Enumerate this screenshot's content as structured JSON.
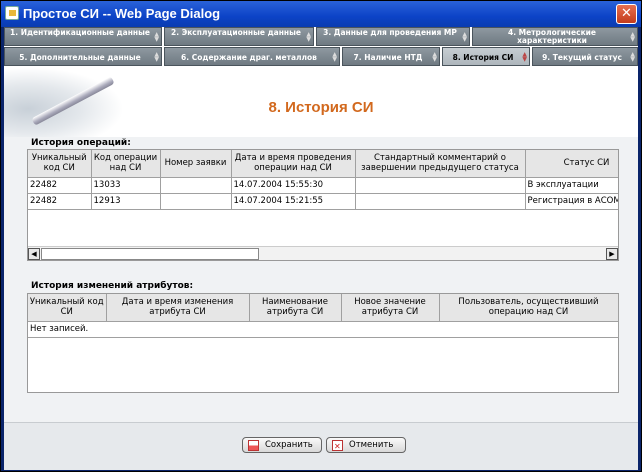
{
  "window": {
    "title": "Простое СИ -- Web Page Dialog",
    "close_glyph": "✕"
  },
  "tabs": [
    {
      "label": "1. Идентификационные данные"
    },
    {
      "label": "2. Эксплуатационные данные"
    },
    {
      "label": "3. Данные для проведения МР"
    },
    {
      "label": "4. Метрологические характеристики"
    },
    {
      "label": "5. Дополнительные данные"
    },
    {
      "label": "6. Содержание драг. металлов"
    },
    {
      "label": "7. Наличие НТД"
    },
    {
      "label": "8. История СИ"
    },
    {
      "label": "9. Текущий статус"
    }
  ],
  "page": {
    "title": "8. История СИ"
  },
  "operations": {
    "label": "История операций:",
    "columns": [
      "Уникальный код СИ",
      "Код операции над СИ",
      "Номер заявки",
      "Дата и время проведения операции над СИ",
      "Стандартный комментарий о завершении предыдущего статуса",
      "Статус СИ"
    ],
    "rows": [
      [
        "22482",
        "13033",
        "",
        "14.07.2004 15:55:30",
        "",
        "В эксплуатации"
      ],
      [
        "22482",
        "12913",
        "",
        "14.07.2004 15:21:55",
        "",
        "Регистрация в АСОМ"
      ]
    ]
  },
  "attributes": {
    "label": "История изменений атрибутов:",
    "columns": [
      "Уникальный код СИ",
      "Дата и время изменения атрибута СИ",
      "Наименование атрибута СИ",
      "Новое значение атрибута СИ",
      "Пользователь, осуществивший операцию над СИ"
    ],
    "empty_text": "Нет записей."
  },
  "buttons": {
    "save": "Сохранить",
    "cancel": "Отменить"
  },
  "scroll": {
    "left_glyph": "◀",
    "right_glyph": "▶"
  }
}
